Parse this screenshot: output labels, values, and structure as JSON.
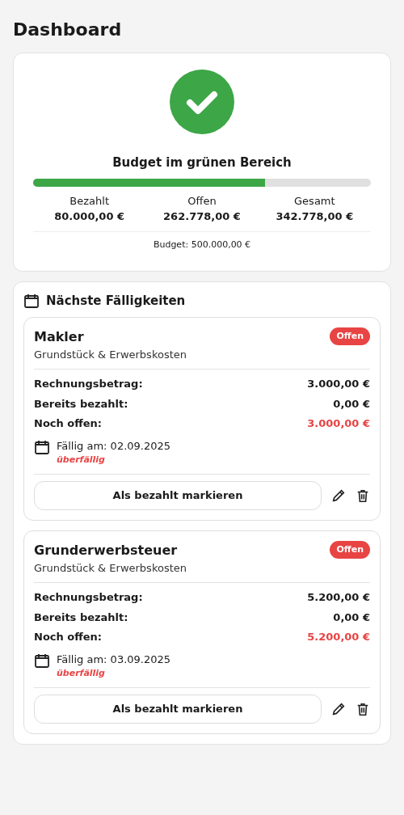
{
  "title": "Dashboard",
  "budget": {
    "status": "Budget im grünen Bereich",
    "level": 0.687,
    "stats": [
      {
        "label": "Bezahlt",
        "value": "80.000,00 €"
      },
      {
        "label": "Offen",
        "value": "262.778,00 €"
      },
      {
        "label": "Gesamt",
        "value": "342.778,00 €"
      }
    ],
    "total": "Budget: 500.000,00 €"
  },
  "due": {
    "title": "Nächste Fälligkeiten",
    "items": [
      {
        "name": "Makler",
        "category": "Grundstück & Erwerbskosten",
        "badge": "Offen",
        "rows": [
          {
            "label": "Rechnungsbetrag:",
            "value": "3.000,00 €",
            "highlight": false
          },
          {
            "label": "Bereits bezahlt:",
            "value": "0,00 €",
            "highlight": false
          },
          {
            "label": "Noch offen:",
            "value": "3.000,00 €",
            "highlight": true
          }
        ],
        "due_date": "Fällig am: 02.09.2025",
        "overdue": "überfällig",
        "button": "Als bezahlt markieren"
      },
      {
        "name": "Grunderwerbsteuer",
        "category": "Grundstück & Erwerbskosten",
        "badge": "Offen",
        "rows": [
          {
            "label": "Rechnungsbetrag:",
            "value": "5.200,00 €",
            "highlight": false
          },
          {
            "label": "Bereits bezahlt:",
            "value": "0,00 €",
            "highlight": false
          },
          {
            "label": "Noch offen:",
            "value": "5.200,00 €",
            "highlight": true
          }
        ],
        "due_date": "Fällig am: 03.09.2025",
        "overdue": "überfällig",
        "button": "Als bezahlt markieren"
      }
    ]
  }
}
